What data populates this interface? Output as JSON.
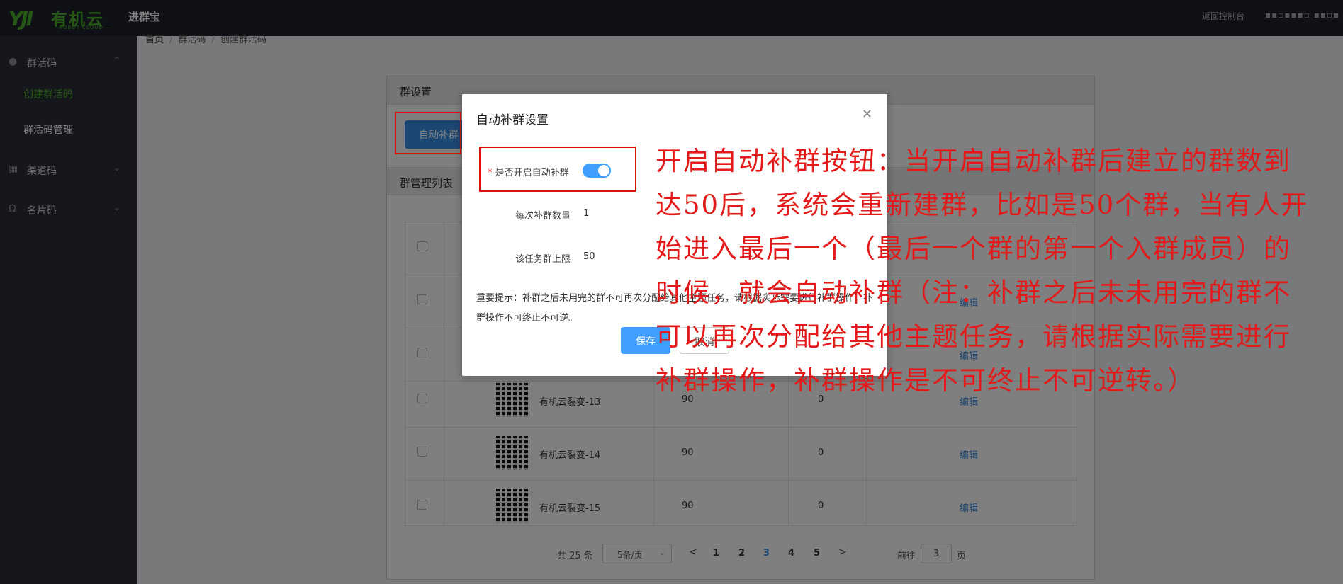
{
  "header": {
    "logo_mark": "YJI",
    "logo_name": "有机云",
    "logo_sub": "— ROBOT CLOUD —",
    "product_name": "进群宝",
    "back_link": "返回控制台",
    "user_name": "▪▪▫▪▪▪▫ ▪▪▫▪"
  },
  "sidebar": {
    "groups": [
      {
        "label": "群活码",
        "icon": "user-icon",
        "expanded": true
      },
      {
        "label": "渠道码",
        "icon": "grid-icon",
        "expanded": false
      },
      {
        "label": "名片码",
        "icon": "headset-icon",
        "expanded": false
      }
    ],
    "sub_items": [
      {
        "label": "创建群活码",
        "active": true
      },
      {
        "label": "群活码管理",
        "active": false
      }
    ]
  },
  "breadcrumb": [
    "首页",
    "群活码",
    "创建群活码"
  ],
  "panel": {
    "settings_title": "群设置",
    "auto_button": "自动补群",
    "list_title": "群管理列表",
    "rows": [
      {
        "name": "有机云裂变-13",
        "limit": "90",
        "count": "0",
        "action": "编辑"
      },
      {
        "name": "有机云裂变-14",
        "limit": "90",
        "count": "0",
        "action": "编辑"
      },
      {
        "name": "有机云裂变-15",
        "limit": "90",
        "count": "0",
        "action": "编辑"
      }
    ],
    "hidden_edit_1": "编辑",
    "hidden_edit_2": "编辑"
  },
  "pager": {
    "total": "共 25 条",
    "page_size": "5条/页",
    "pages": [
      "1",
      "2",
      "3",
      "4",
      "5"
    ],
    "active_page": "3",
    "goto_prefix": "前往",
    "goto_value": "3",
    "goto_suffix": "页"
  },
  "modal": {
    "title": "自动补群设置",
    "switch_label": "是否开启自动补群",
    "switch_on": true,
    "count_label": "每次补群数量",
    "count_value": "1",
    "limit_label": "该任务群上限",
    "limit_value": "50",
    "notice": "重要提示：补群之后未用完的群不可再次分配给其他主题任务，请根据实际需要进行补群操作，补群操作不可终止不可逆。",
    "save": "保存",
    "cancel": "取消"
  },
  "annotation": "开启自动补群按钮：当开启自动补群后建立的群数到达50后，系统会重新建群，比如是50个群，当有人开始进入最后一个（最后一个群的第一个入群成员）的时候，就会自动补群（注：补群之后未未用完的群不可以再次分配给其他主题任务，请根据实际需要进行补群操作，补群操作是不可终止不可逆转。）",
  "colors": {
    "brand_green": "#4caf2e",
    "primary_blue": "#409eff",
    "annotation_red": "#e21a1a",
    "topbar_bg": "#1e222d",
    "sidebar_bg": "#2b2f3a"
  }
}
